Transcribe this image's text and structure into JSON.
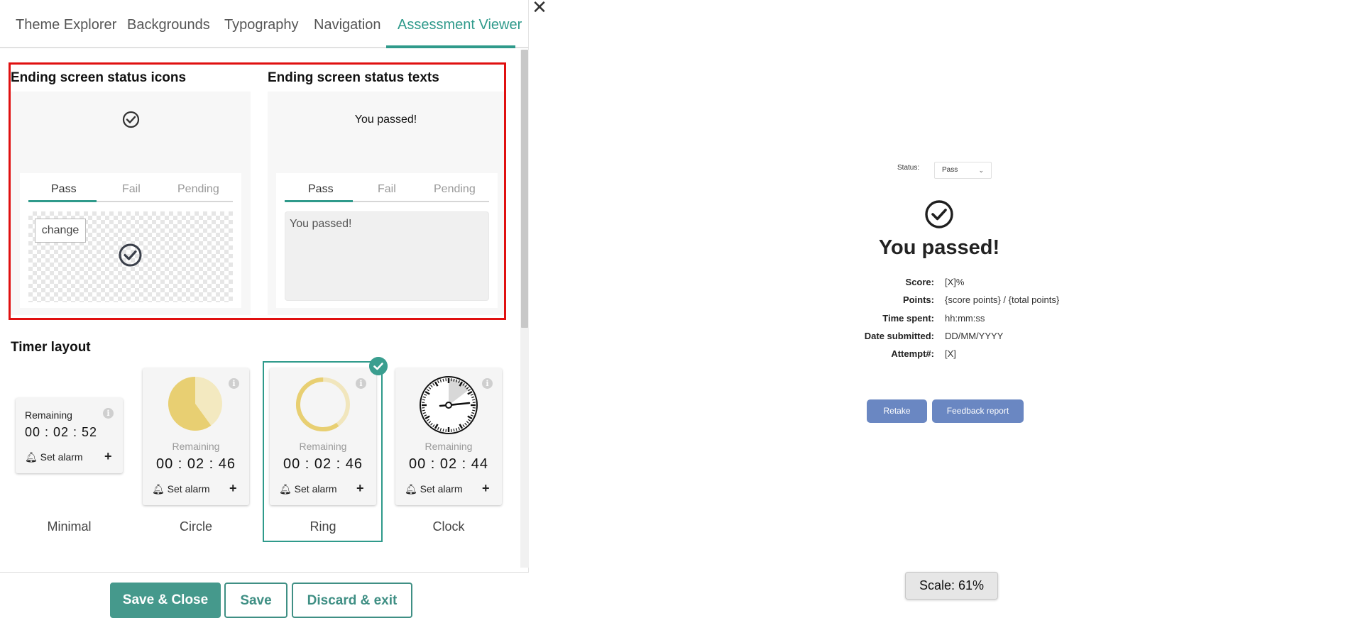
{
  "tabs": [
    {
      "label": "Theme Explorer",
      "active": false
    },
    {
      "label": "Backgrounds",
      "active": false
    },
    {
      "label": "Typography",
      "active": false
    },
    {
      "label": "Navigation",
      "active": false
    },
    {
      "label": "Assessment Viewer",
      "active": true
    }
  ],
  "icons": {
    "close": "close-icon",
    "check": "check-circle-icon",
    "bell": "bell-icon",
    "info": "info-icon",
    "plus": "plus-icon",
    "chevron": "chevron-down-icon"
  },
  "colors": {
    "accent": "#2f9a8b",
    "highlight_border": "#e01010",
    "preview_button": "#6a87c2",
    "timer_fill": "#e8cf72"
  },
  "ending_icons": {
    "title": "Ending screen status icons",
    "subtabs": [
      "Pass",
      "Fail",
      "Pending"
    ],
    "active_subtab": "Pass",
    "change_label": "change"
  },
  "ending_texts": {
    "title": "Ending screen status texts",
    "preview_text": "You passed!",
    "subtabs": [
      "Pass",
      "Fail",
      "Pending"
    ],
    "active_subtab": "Pass",
    "text_value": "You passed!"
  },
  "timer": {
    "title": "Timer layout",
    "selected": "Ring",
    "options": [
      {
        "name": "Minimal",
        "remaining_label": "Remaining",
        "time": "00 : 02 : 52",
        "alarm_label": "Set alarm"
      },
      {
        "name": "Circle",
        "remaining_label": "Remaining",
        "time": "00 : 02 : 46",
        "alarm_label": "Set alarm",
        "fill_fraction": 0.6
      },
      {
        "name": "Ring",
        "remaining_label": "Remaining",
        "time": "00 : 02 : 46",
        "alarm_label": "Set alarm",
        "fill_fraction": 0.6
      },
      {
        "name": "Clock",
        "remaining_label": "Remaining",
        "time": "00 : 02 : 44",
        "alarm_label": "Set alarm"
      }
    ]
  },
  "footer": {
    "save_close": "Save & Close",
    "save": "Save",
    "discard": "Discard & exit"
  },
  "preview": {
    "status_label": "Status:",
    "status_value": "Pass",
    "heading": "You passed!",
    "rows": [
      {
        "label": "Score:",
        "value": "[X]%"
      },
      {
        "label": "Points:",
        "value": "{score points} / {total points}"
      },
      {
        "label": "Time spent:",
        "value": "hh:mm:ss"
      },
      {
        "label": "Date submitted:",
        "value": "DD/MM/YYYY"
      },
      {
        "label": "Attempt#:",
        "value": "[X]"
      }
    ],
    "retake": "Retake",
    "feedback": "Feedback report",
    "scale": "Scale: 61%"
  }
}
